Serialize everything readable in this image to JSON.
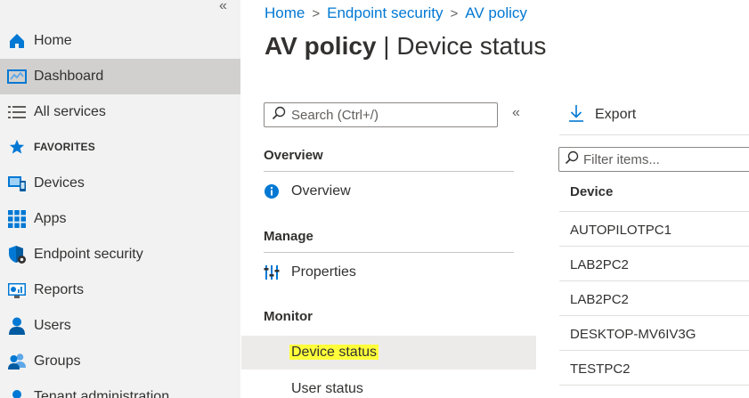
{
  "nav": {
    "collapse_glyph": "«",
    "items": [
      {
        "label": "Home",
        "icon": "home-icon"
      },
      {
        "label": "Dashboard",
        "icon": "dashboard-icon",
        "active": true
      },
      {
        "label": "All services",
        "icon": "list-icon"
      },
      {
        "label": "FAVORITES",
        "icon": "star-icon"
      },
      {
        "label": "Devices",
        "icon": "devices-icon"
      },
      {
        "label": "Apps",
        "icon": "apps-grid-icon"
      },
      {
        "label": "Endpoint security",
        "icon": "shield-icon"
      },
      {
        "label": "Reports",
        "icon": "reports-icon"
      },
      {
        "label": "Users",
        "icon": "user-icon"
      },
      {
        "label": "Groups",
        "icon": "groups-icon"
      },
      {
        "label": "Tenant administration",
        "icon": "tenant-icon"
      }
    ]
  },
  "breadcrumb": {
    "items": [
      "Home",
      "Endpoint security",
      "AV policy"
    ],
    "separator": ">"
  },
  "title": {
    "main": "AV policy",
    "divider": "|",
    "sub": "Device status"
  },
  "menu": {
    "search_placeholder": "Search (Ctrl+/)",
    "collapse_glyph": "«",
    "sections": [
      {
        "heading": "Overview",
        "items": [
          {
            "label": "Overview",
            "icon": "info-icon"
          }
        ]
      },
      {
        "heading": "Manage",
        "items": [
          {
            "label": "Properties",
            "icon": "properties-icon"
          }
        ]
      },
      {
        "heading": "Monitor",
        "items": [
          {
            "label": "Device status",
            "selected": true,
            "highlighted": true
          },
          {
            "label": "User status"
          }
        ]
      }
    ]
  },
  "content": {
    "export_label": "Export",
    "filter_placeholder": "Filter items...",
    "column_header": "Device",
    "rows": [
      "AUTOPILOTPC1",
      "LAB2PC2",
      "LAB2PC2",
      "DESKTOP-MV6IV3G",
      "TESTPC2"
    ]
  },
  "colors": {
    "accent": "#0078d4",
    "highlight": "#ffff3a",
    "nav_bg": "#f2f2f2",
    "nav_active": "#d2d0ce"
  }
}
